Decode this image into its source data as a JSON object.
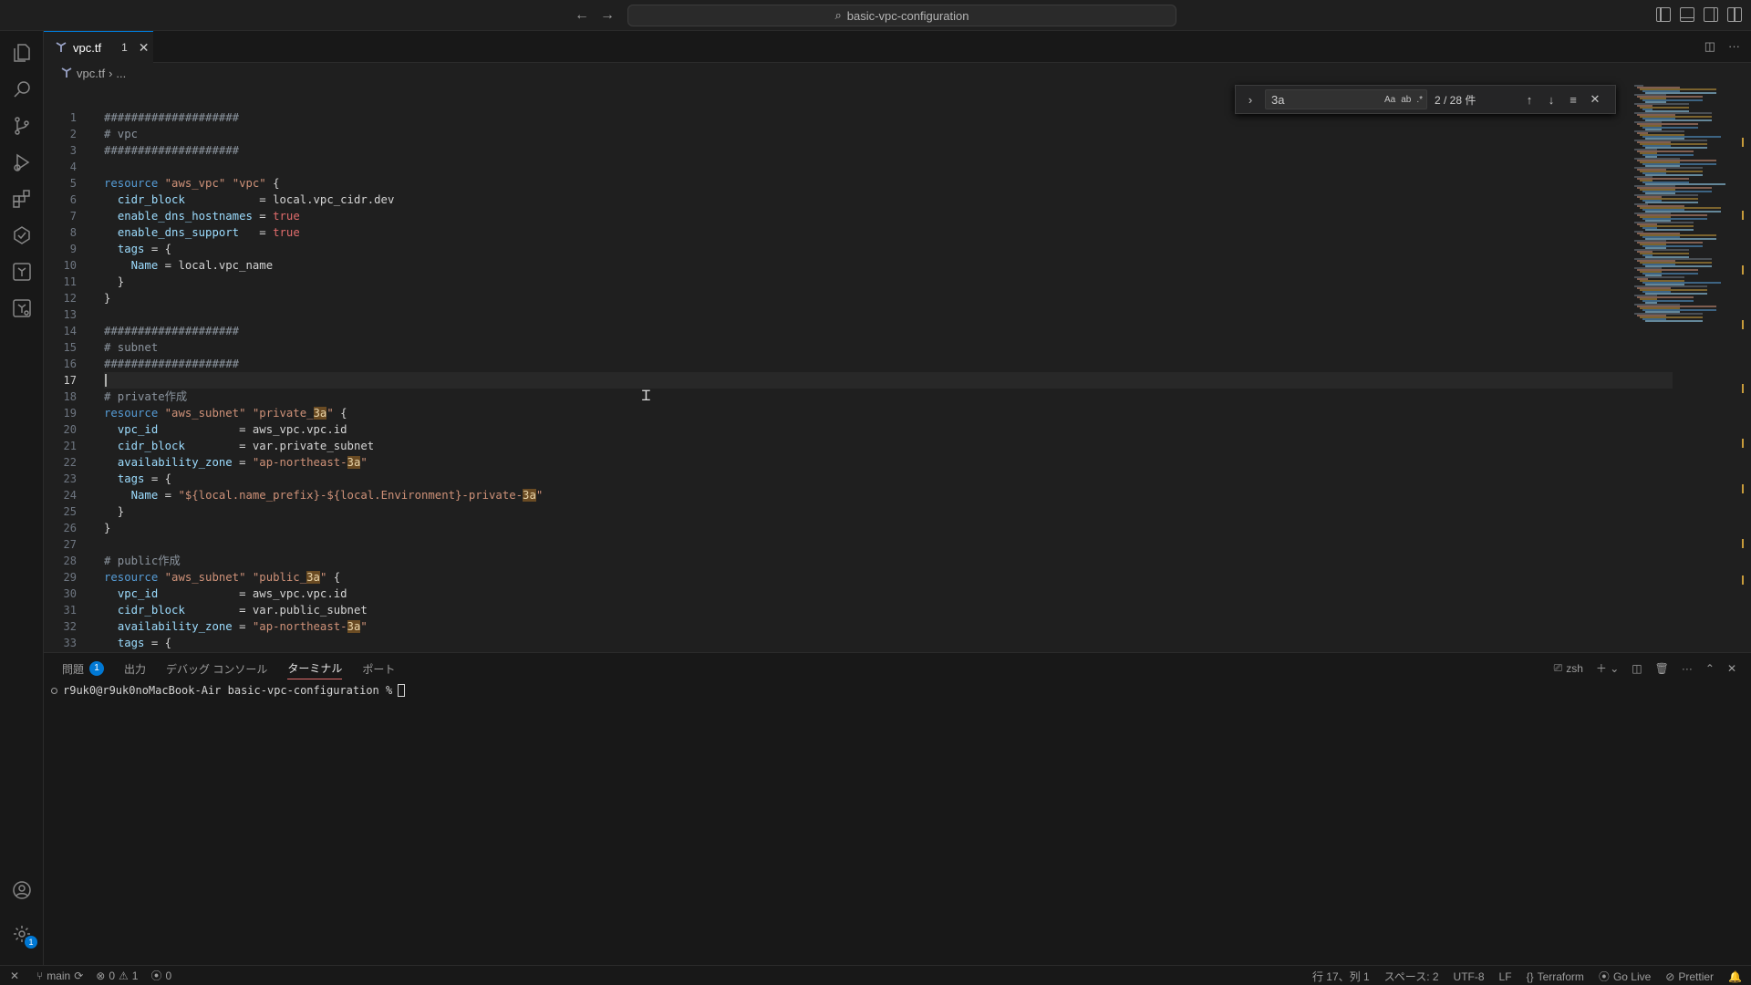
{
  "titlebar": {
    "back": "←",
    "forward": "→",
    "search_text": "basic-vpc-configuration"
  },
  "tab": {
    "name": "vpc.tf",
    "count": "1",
    "close": "✕"
  },
  "breadcrumb": {
    "file": "vpc.tf",
    "sep": "›",
    "rest": "..."
  },
  "find": {
    "query": "3a",
    "opt_case": "Aa",
    "opt_word": "ab",
    "opt_regex": ".*",
    "count": "2 / 28 件"
  },
  "lines": [
    {
      "n": "1",
      "text": "####################"
    },
    {
      "n": "2",
      "text": "# vpc"
    },
    {
      "n": "3",
      "text": "####################"
    },
    {
      "n": "4",
      "text": ""
    },
    {
      "n": "5",
      "text": "resource \"aws_vpc\" \"vpc\" {"
    },
    {
      "n": "6",
      "text": "  cidr_block           = local.vpc_cidr.dev"
    },
    {
      "n": "7",
      "text": "  enable_dns_hostnames = true"
    },
    {
      "n": "8",
      "text": "  enable_dns_support   = true"
    },
    {
      "n": "9",
      "text": "  tags = {"
    },
    {
      "n": "10",
      "text": "    Name = local.vpc_name"
    },
    {
      "n": "11",
      "text": "  }"
    },
    {
      "n": "12",
      "text": "}"
    },
    {
      "n": "13",
      "text": ""
    },
    {
      "n": "14",
      "text": "####################"
    },
    {
      "n": "15",
      "text": "# subnet"
    },
    {
      "n": "16",
      "text": "####################"
    },
    {
      "n": "17",
      "text": ""
    },
    {
      "n": "18",
      "text": "# private作成"
    },
    {
      "n": "19",
      "text": "resource \"aws_subnet\" \"private_3a\" {"
    },
    {
      "n": "20",
      "text": "  vpc_id            = aws_vpc.vpc.id"
    },
    {
      "n": "21",
      "text": "  cidr_block        = var.private_subnet"
    },
    {
      "n": "22",
      "text": "  availability_zone = \"ap-northeast-3a\""
    },
    {
      "n": "23",
      "text": "  tags = {"
    },
    {
      "n": "24",
      "text": "    Name = \"${local.name_prefix}-${local.Environment}-private-3a\""
    },
    {
      "n": "25",
      "text": "  }"
    },
    {
      "n": "26",
      "text": "}"
    },
    {
      "n": "27",
      "text": ""
    },
    {
      "n": "28",
      "text": "# public作成"
    },
    {
      "n": "29",
      "text": "resource \"aws_subnet\" \"public_3a\" {"
    },
    {
      "n": "30",
      "text": "  vpc_id            = aws_vpc.vpc.id"
    },
    {
      "n": "31",
      "text": "  cidr_block        = var.public_subnet"
    },
    {
      "n": "32",
      "text": "  availability_zone = \"ap-northeast-3a\""
    },
    {
      "n": "33",
      "text": "  tags = {"
    }
  ],
  "panel": {
    "tabs": [
      {
        "label": "問題",
        "badge": "1"
      },
      {
        "label": "出力"
      },
      {
        "label": "デバッグ コンソール"
      },
      {
        "label": "ターミナル",
        "active": true
      },
      {
        "label": "ポート"
      }
    ],
    "shell": "zsh",
    "prompt": "r9uk0@r9uk0noMacBook-Air basic-vpc-configuration %"
  },
  "status": {
    "branch": "main",
    "errors": "0",
    "warnings": "1",
    "ports": "0",
    "position": "行 17、列 1",
    "spaces": "スペース: 2",
    "encoding": "UTF-8",
    "eol": "LF",
    "language": "Terraform",
    "golive": "Go Live",
    "prettier": "Prettier"
  },
  "colors": {
    "accent": "#0078d4",
    "match_highlight": "#6a4b23",
    "terminal_tab_underline": "#e06c6c"
  }
}
